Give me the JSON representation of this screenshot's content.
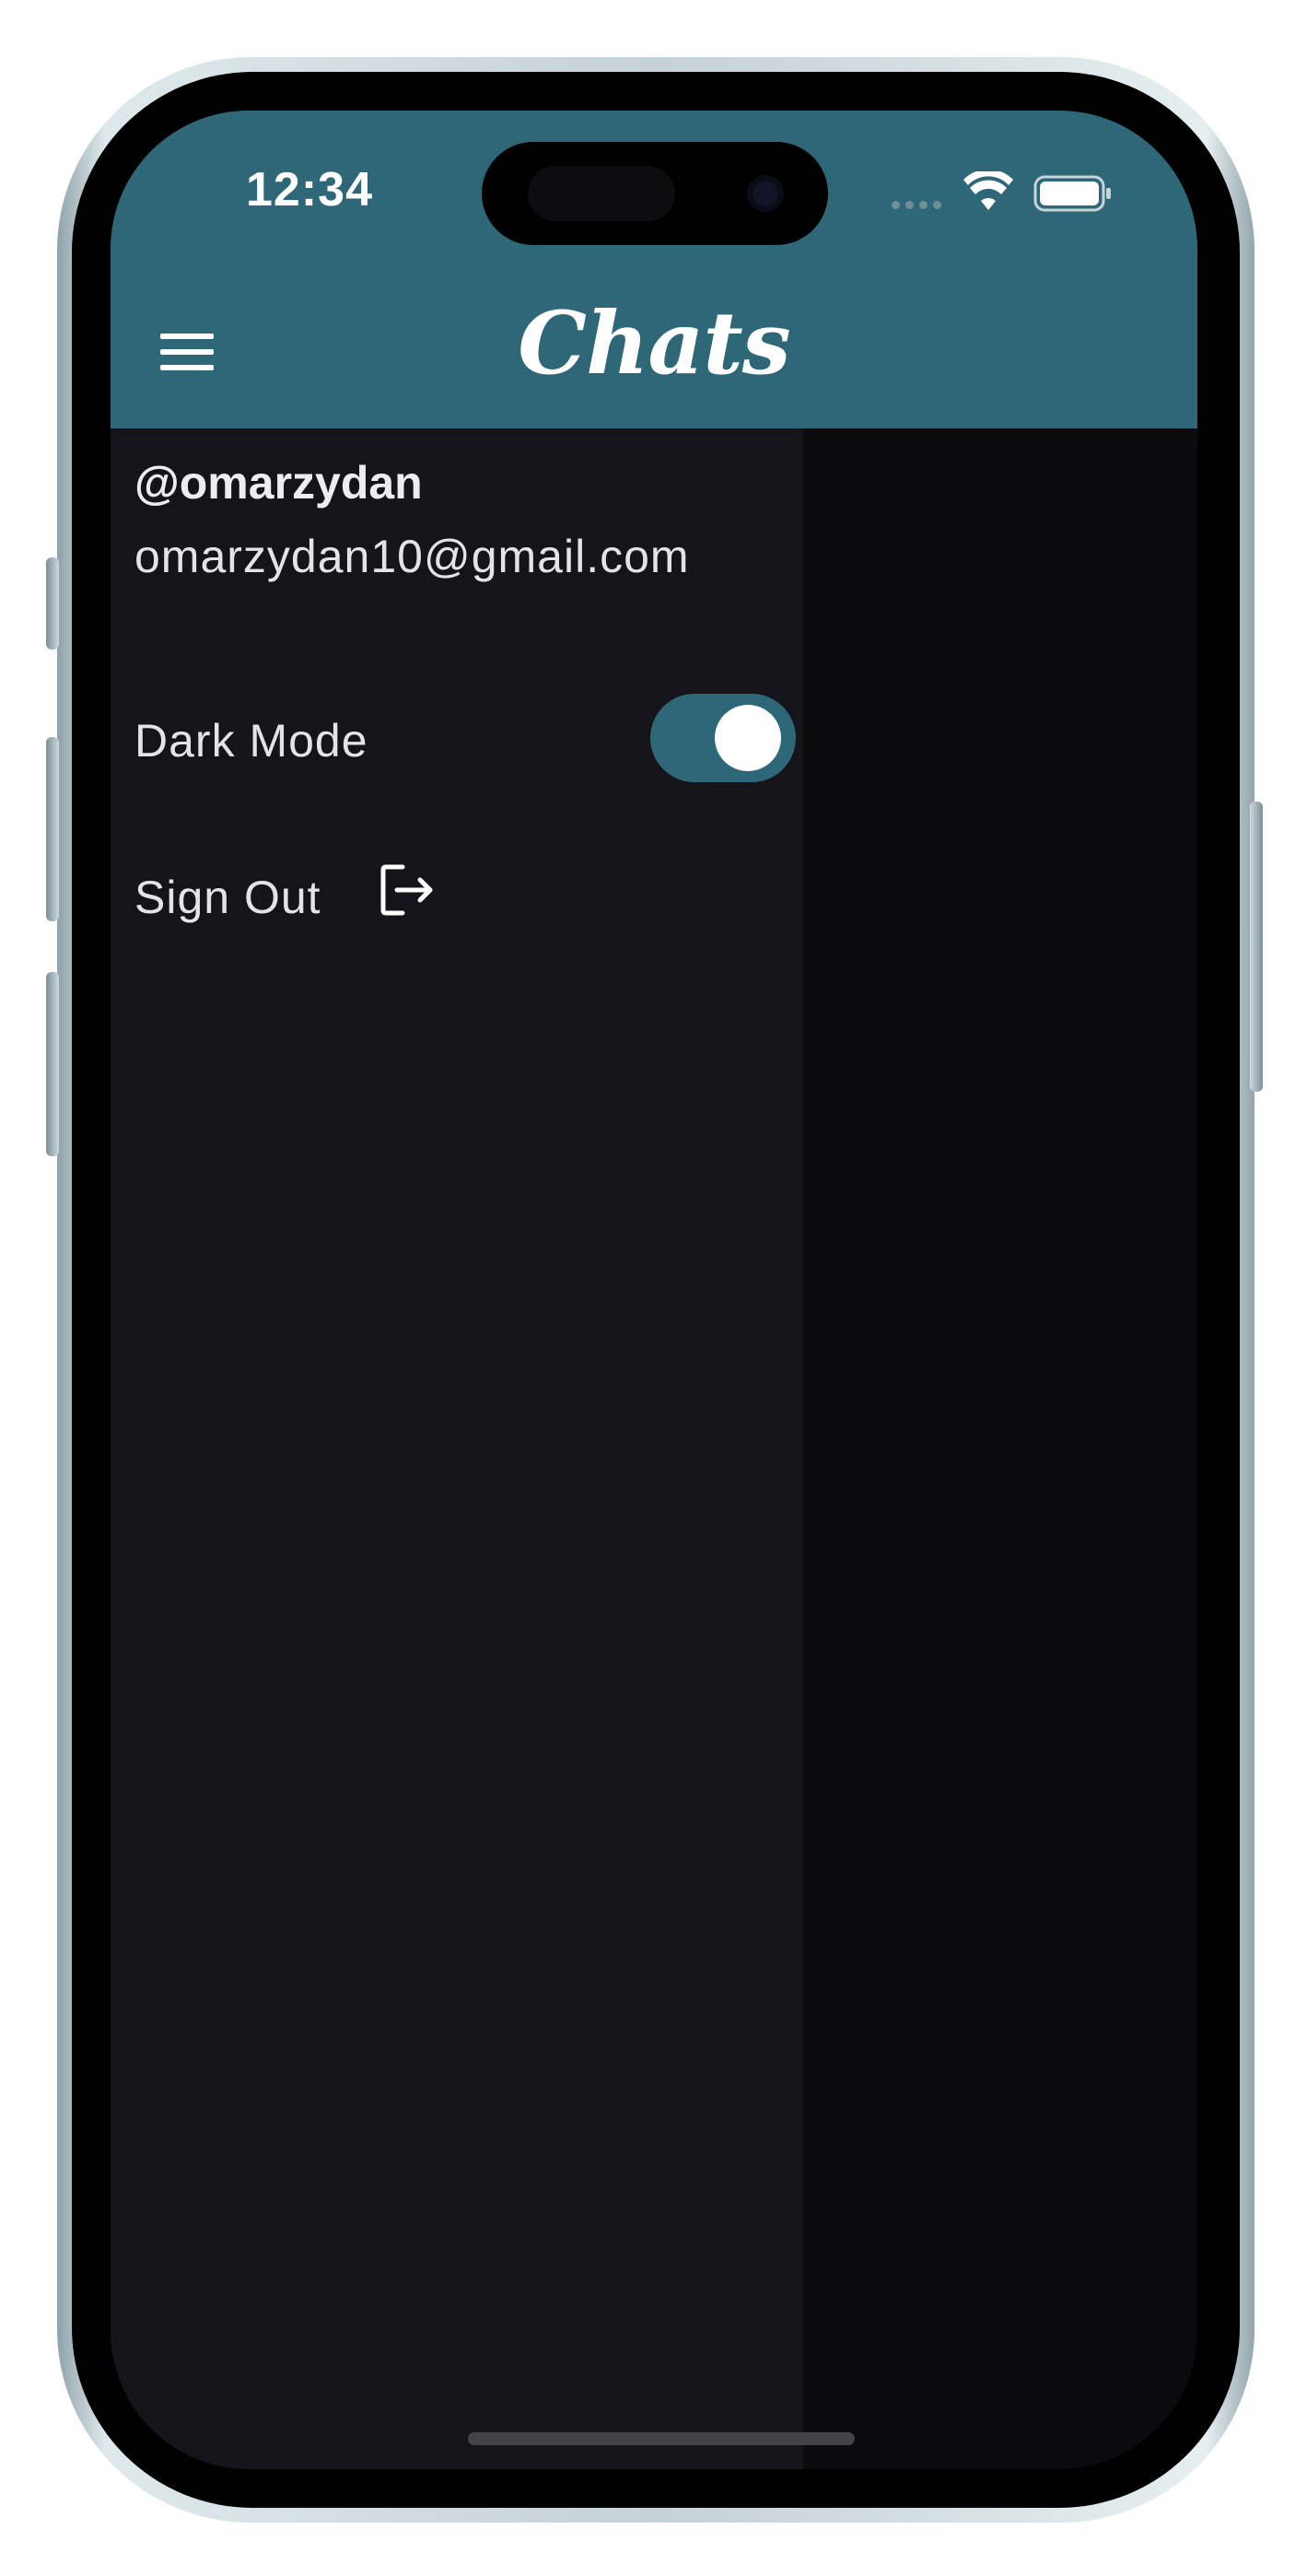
{
  "status_bar": {
    "time": "12:34"
  },
  "header": {
    "title": "Chats",
    "menu_icon": "hamburger-menu-icon"
  },
  "drawer": {
    "username": "@omarzydan",
    "email": "omarzydan10@gmail.com",
    "dark_mode": {
      "label": "Dark Mode",
      "enabled": true
    },
    "sign_out": {
      "label": "Sign Out",
      "icon": "sign-out-icon"
    }
  },
  "colors": {
    "accent": "#2e6878",
    "drawer_background": "#16141b",
    "screen_background": "#0b0b0d",
    "text": "#e4e4e8"
  }
}
